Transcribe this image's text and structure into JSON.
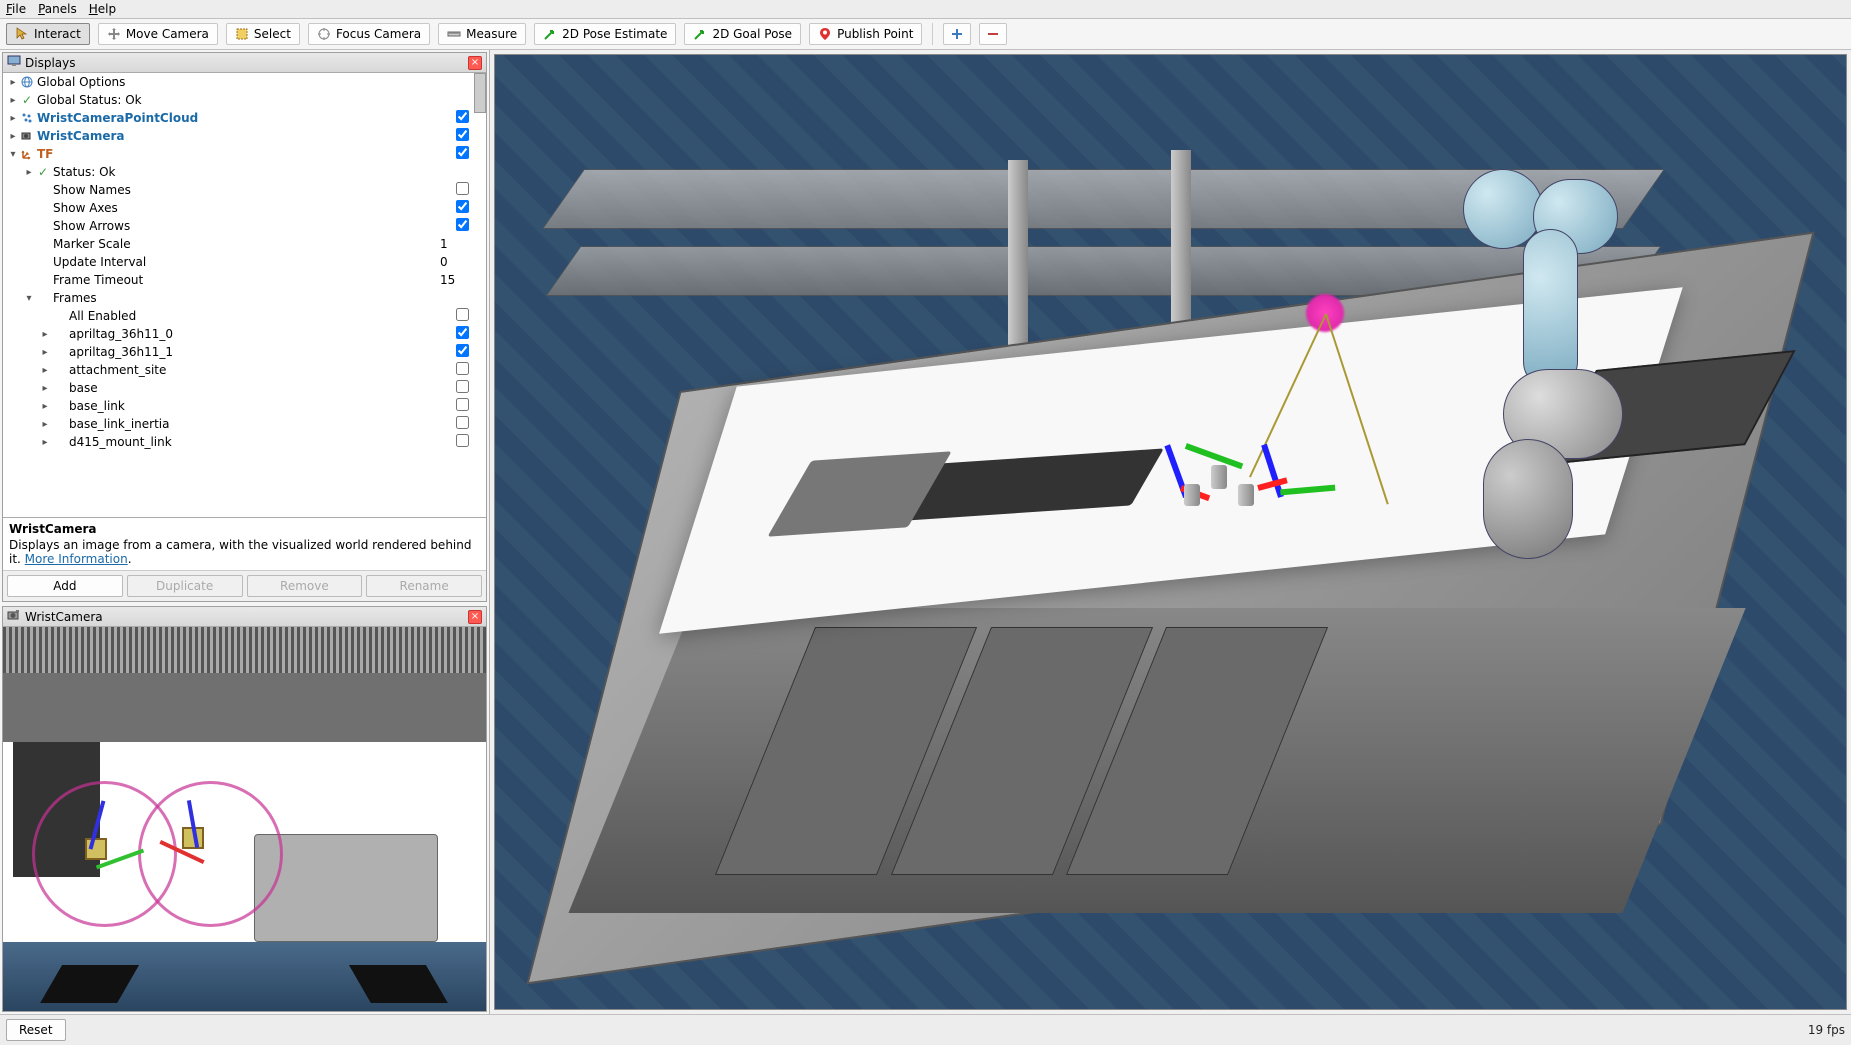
{
  "menu": {
    "file": "File",
    "panels": "Panels",
    "help": "Help"
  },
  "toolbar": {
    "interact": "Interact",
    "move_camera": "Move Camera",
    "select": "Select",
    "focus_camera": "Focus Camera",
    "measure": "Measure",
    "pose_estimate": "2D Pose Estimate",
    "goal_pose": "2D Goal Pose",
    "publish_point": "Publish Point"
  },
  "displays": {
    "title": "Displays",
    "items": [
      {
        "label": "Global Options",
        "icon": "globe",
        "expandable": true
      },
      {
        "label": "Global Status: Ok",
        "icon": "check",
        "expandable": true
      },
      {
        "label": "WristCameraPointCloud",
        "icon": "pointcloud",
        "link": true,
        "checked": true,
        "expandable": true
      },
      {
        "label": "WristCamera",
        "icon": "camera",
        "link": true,
        "checked": true,
        "expandable": true
      },
      {
        "label": "TF",
        "icon": "tf",
        "tf": true,
        "checked": true,
        "expanded": true,
        "expandable": true
      }
    ],
    "tf_children": [
      {
        "label": "Status: Ok",
        "icon": "check",
        "expandable": true
      },
      {
        "label": "Show Names",
        "checked": false
      },
      {
        "label": "Show Axes",
        "checked": true
      },
      {
        "label": "Show Arrows",
        "checked": true
      },
      {
        "label": "Marker Scale",
        "value": "1"
      },
      {
        "label": "Update Interval",
        "value": "0"
      },
      {
        "label": "Frame Timeout",
        "value": "15"
      },
      {
        "label": "Frames",
        "expanded": true,
        "expandable": true
      }
    ],
    "frames": [
      {
        "label": "All Enabled",
        "checked": false
      },
      {
        "label": "apriltag_36h11_0",
        "checked": true,
        "expandable": true
      },
      {
        "label": "apriltag_36h11_1",
        "checked": true,
        "expandable": true
      },
      {
        "label": "attachment_site",
        "checked": false,
        "expandable": true
      },
      {
        "label": "base",
        "checked": false,
        "expandable": true
      },
      {
        "label": "base_link",
        "checked": false,
        "expandable": true
      },
      {
        "label": "base_link_inertia",
        "checked": false,
        "expandable": true
      },
      {
        "label": "d415_mount_link",
        "checked": false,
        "expandable": true
      }
    ]
  },
  "description": {
    "title": "WristCamera",
    "body": "Displays an image from a camera, with the visualized world rendered behind it. ",
    "link": "More Information"
  },
  "buttons": {
    "add": "Add",
    "duplicate": "Duplicate",
    "remove": "Remove",
    "rename": "Rename"
  },
  "wrist_panel": {
    "title": "WristCamera"
  },
  "bottom": {
    "reset": "Reset",
    "fps": "19 fps"
  }
}
